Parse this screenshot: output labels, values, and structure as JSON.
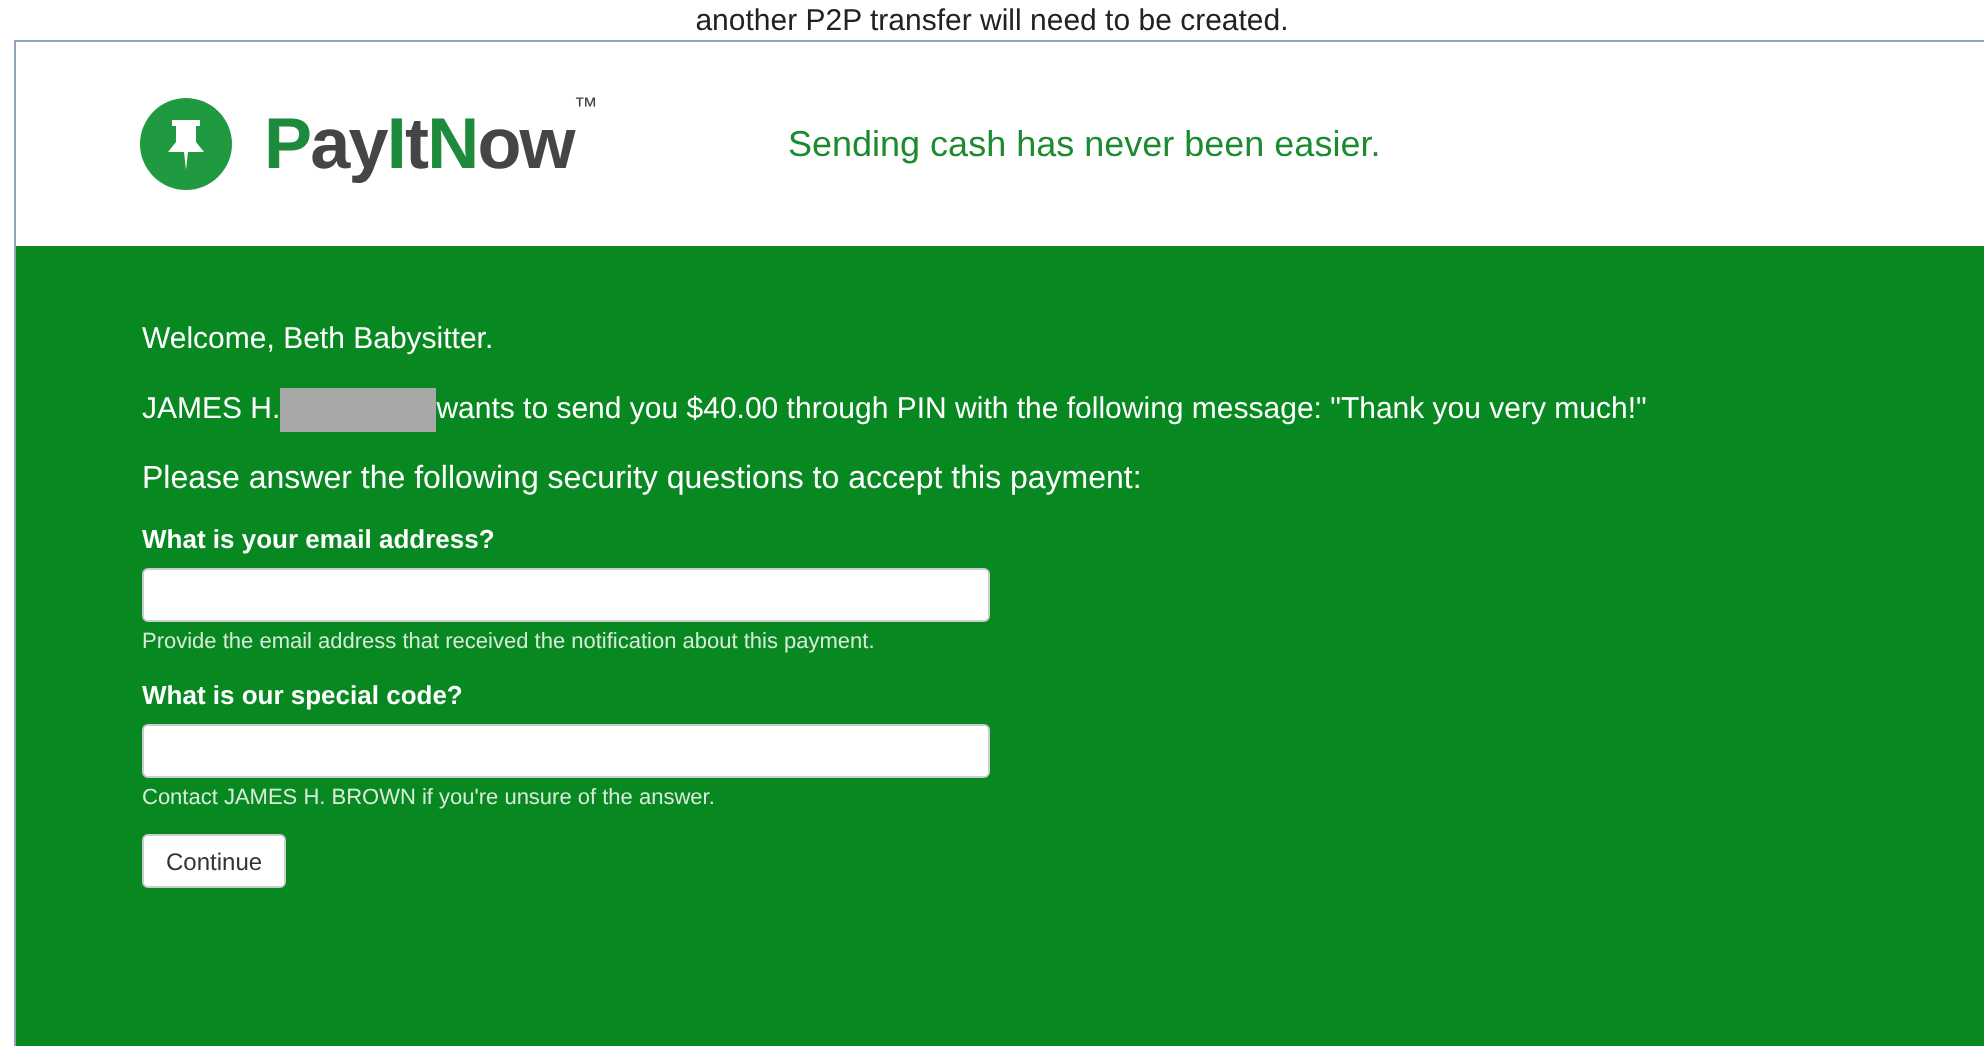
{
  "caption": "another P2P transfer will need to be created.",
  "header": {
    "logo": [
      {
        "text": "P",
        "accent": true
      },
      {
        "text": "ay",
        "accent": false
      },
      {
        "text": "I",
        "accent": true
      },
      {
        "text": "t",
        "accent": false
      },
      {
        "text": "N",
        "accent": true
      },
      {
        "text": "ow",
        "accent": false
      }
    ],
    "trademark": "™",
    "tagline": "Sending cash has never been easier."
  },
  "body": {
    "welcome": "Welcome, Beth Babysitter.",
    "message_start": "JAMES H.",
    "message_rest": "wants to send you $40.00 through PIN with the following message: \"Thank you very much!\"",
    "instruction": "Please answer the following security questions to accept this payment:",
    "questions": [
      {
        "label": "What is your email address?",
        "hint": "Provide the email address that received the notification about this payment."
      },
      {
        "label": "What is our special code?",
        "hint": "Contact JAMES H. BROWN if you're unsure of the answer."
      }
    ],
    "button": "Continue"
  }
}
